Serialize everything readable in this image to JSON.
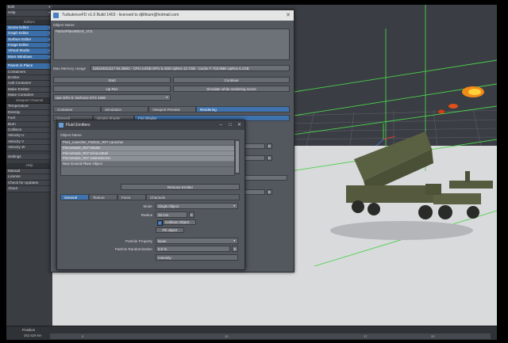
{
  "left_menu": {
    "items_top": [
      {
        "label": "Edit",
        "arrow": true
      },
      {
        "label": "Help",
        "arrow": true
      }
    ],
    "editors_head": "Editors",
    "editors": [
      {
        "label": "Scene Editor",
        "arrow": true
      },
      {
        "label": "Graph Editor",
        "arrow": true
      },
      {
        "label": "Surface Editor",
        "arrow": true
      },
      {
        "label": "Image Editor",
        "arrow": true
      },
      {
        "label": "Virtual Studio",
        "arrow": true
      },
      {
        "label": "More Windows",
        "arrow": true
      }
    ],
    "tools": [
      {
        "label": "Parent in Place",
        "blue": true
      },
      {
        "label": "Containers"
      },
      {
        "label": "Emitter"
      },
      {
        "label": "Add Container"
      },
      {
        "label": "Make Emitter"
      },
      {
        "label": "Make Container"
      }
    ],
    "viewport_channel_head": "Viewport Channel",
    "channels": [
      "Temperature",
      "Density",
      "Fuel",
      "Burn",
      "Collision",
      "Velocity U",
      "Velocity V",
      "Velocity W"
    ],
    "settings": "Settings",
    "help_head": "Help",
    "help": [
      "Manual",
      "License",
      "Check for Updates",
      "About"
    ]
  },
  "status": {
    "position_label": "Position",
    "position_value": "262.629 km",
    "timeline_ticks": [
      "0",
      "10",
      "17",
      "20"
    ]
  },
  "turbulence": {
    "title": "TurbulenceFD v1.0 Build 1403 - licensed to djlithium@hotmail.com",
    "object_name_label": "Object Name",
    "object_name_value": "PatriotPlanetBlock_VOL",
    "max_memory_label": "Max Memory Usage",
    "memory_info": "320x240x1117 94.29MV - CPU 6.9GB GPU 5.4GB UpRes 42.7GB - Cache F 703.9MB UpRes 6.1GB",
    "start_btn": "Start",
    "continue_btn": "Continue",
    "uprez_btn": "Up Rez",
    "simulate_rendering_btn": "Simulate while rendering scene",
    "gpu_select": "Use GPU 0: GeForce GTX 1080",
    "tabs": [
      "Container",
      "Simulation",
      "Viewport Preview",
      "Rendering"
    ],
    "subtabs": [
      "General",
      "Smoke Shader",
      "Fire Shader"
    ]
  },
  "fluid_emitters": {
    "title": "Fluid Emitters",
    "object_name_label": "Object Name",
    "objects": [
      "Pvs1_Launcher_PatriotL_R07 Launcher",
      "PierceMade_R07 Missile",
      "PierceMade_R07 ExhaustBall",
      "PierceMade_R07 IntakeBlocker",
      "New Ground Plane Object"
    ],
    "remove_btn": "Remove Emitter",
    "tabs": [
      "General",
      "Texture",
      "Force",
      "Channels"
    ],
    "mode_label": "Mode",
    "mode_value": "Single Object",
    "radius_label": "Radius",
    "radius_value": "25 mm",
    "collision_label": "Collision Object",
    "fill_object_btn": "Fill object",
    "particle_property_label": "Particle Property",
    "particle_property_value": "None",
    "particle_randomization_label": "Particle Randomization",
    "particle_randomization_value": "0.0 %",
    "intensity_label": "Intensity"
  }
}
